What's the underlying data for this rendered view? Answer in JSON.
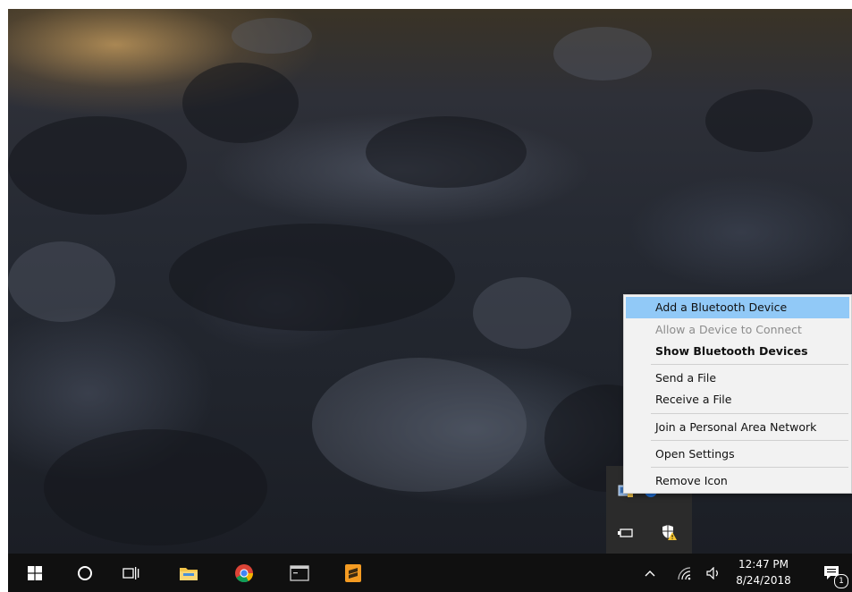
{
  "context_menu": {
    "items": [
      {
        "label": "Add a Bluetooth Device",
        "state": "highlighted"
      },
      {
        "label": "Allow a Device to Connect",
        "state": "disabled"
      },
      {
        "label": "Show Bluetooth Devices",
        "state": "default-bold"
      },
      {
        "label": "Send a File",
        "state": "normal"
      },
      {
        "label": "Receive a File",
        "state": "normal"
      },
      {
        "label": "Join a Personal Area Network",
        "state": "normal"
      },
      {
        "label": "Open Settings",
        "state": "normal"
      },
      {
        "label": "Remove Icon",
        "state": "normal"
      }
    ]
  },
  "tray_overflow": {
    "icons": [
      "network-drive-icon",
      "bluetooth-icon",
      "usb-device-icon",
      "windows-security-icon"
    ]
  },
  "taskbar": {
    "pinned": [
      "start-icon",
      "cortana-search-icon",
      "task-view-icon",
      "file-explorer-icon",
      "chrome-icon",
      "terminal-icon",
      "sublime-text-icon"
    ],
    "tray": [
      "chevron-up-icon",
      "wifi-icon",
      "volume-icon"
    ],
    "clock": {
      "time": "12:47 PM",
      "date": "8/24/2018"
    },
    "notifications": {
      "count": "1"
    }
  },
  "colors": {
    "taskbar_bg": "#101010",
    "menu_bg": "#f2f2f2",
    "menu_highlight": "#91c9f7",
    "tray_flyout_bg": "#2b2b2b",
    "explorer_yellow": "#f4c54a",
    "sublime_orange": "#f49b22"
  }
}
